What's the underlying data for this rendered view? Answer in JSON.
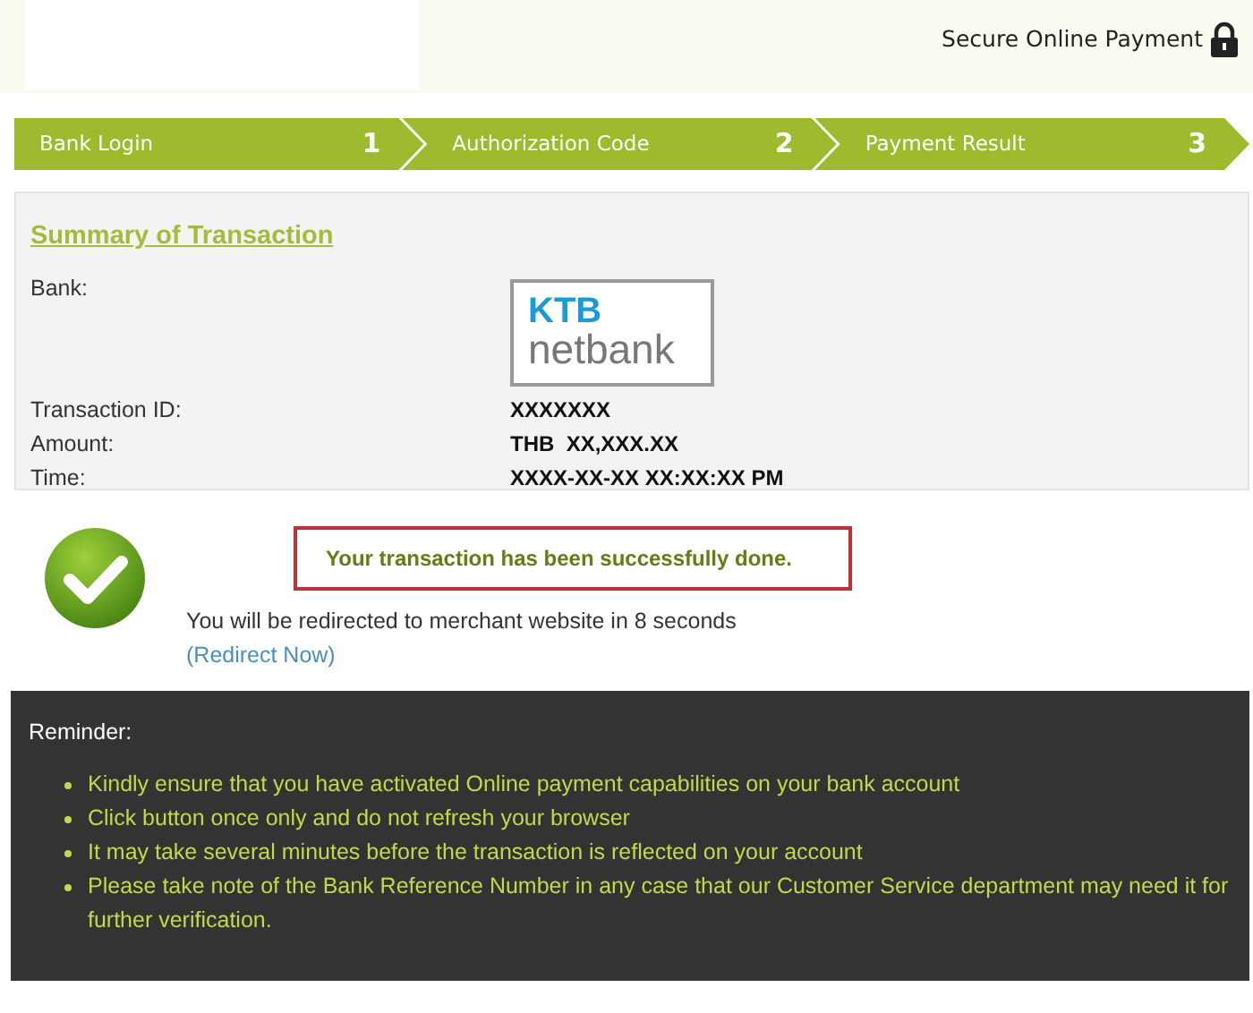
{
  "header": {
    "secure_label": "Secure Online Payment"
  },
  "steps": [
    {
      "label": "Bank Login",
      "number": "1"
    },
    {
      "label": "Authorization Code",
      "number": "2"
    },
    {
      "label": "Payment Result",
      "number": "3"
    }
  ],
  "summary": {
    "title": "Summary of Transaction",
    "bank_label": "Bank:",
    "logo": {
      "line1": "KTB",
      "line2": "netbank"
    },
    "fields": [
      {
        "label": "Transaction ID:",
        "value": "XXXXXXX"
      },
      {
        "label": "Amount:",
        "value": "THB  XX,XXX.XX"
      },
      {
        "label": "Time:",
        "value": "XXXX-XX-XX XX:XX:XX PM"
      }
    ]
  },
  "result": {
    "message": "Your transaction has been successfully done.",
    "redirect_text": "You will be redirected to merchant website in 8 seconds",
    "redirect_link": "(Redirect Now)"
  },
  "reminder": {
    "title": "Reminder:",
    "items": [
      "Kindly ensure that you have activated Online payment capabilities on your bank account",
      "Click button once only and do not refresh your browser",
      "It may take several minutes before the transaction is reflected on your account",
      "Please take note of the Bank Reference Number in any case that our Customer Service department may need it for further verification."
    ]
  }
}
